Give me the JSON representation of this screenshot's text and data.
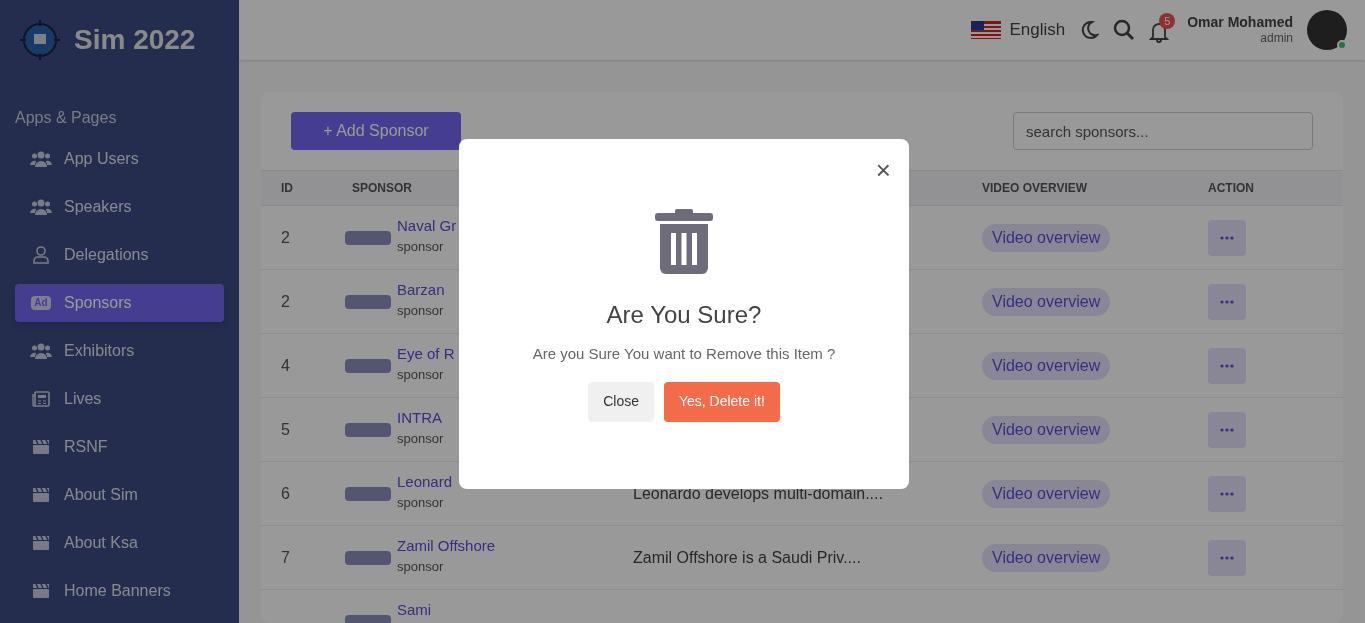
{
  "brand": {
    "title": "Sim 2022"
  },
  "sidebar": {
    "section": "Apps & Pages",
    "items": [
      {
        "label": "App Users",
        "kind": "users",
        "selected": false
      },
      {
        "label": "Speakers",
        "kind": "users",
        "selected": false
      },
      {
        "label": "Delegations",
        "kind": "user",
        "selected": false
      },
      {
        "label": "Sponsors",
        "kind": "ad",
        "icon_text": "Ad",
        "selected": true
      },
      {
        "label": "Exhibitors",
        "kind": "users",
        "selected": false
      },
      {
        "label": "Lives",
        "kind": "newspaper",
        "selected": false
      },
      {
        "label": "RSNF",
        "kind": "clapperboard",
        "selected": false
      },
      {
        "label": "About Sim",
        "kind": "clapperboard",
        "selected": false
      },
      {
        "label": "About Ksa",
        "kind": "clapperboard",
        "selected": false
      },
      {
        "label": "Home Banners",
        "kind": "clapperboard",
        "selected": false
      }
    ]
  },
  "header": {
    "language": "English",
    "notifications": "5",
    "user": {
      "name": "Omar Mohamed",
      "role": "admin",
      "online": true
    }
  },
  "toolbar": {
    "add_button": "+ Add Sponsor",
    "search": {
      "placeholder": "search sponsors..."
    }
  },
  "table": {
    "columns": [
      "ID",
      "SPONSOR",
      "VIDEO OVERVIEW",
      "ACTION"
    ],
    "rows": [
      {
        "id": "2",
        "name": "Naval Gr",
        "subtitle": "sponsor",
        "video": "Video overview"
      },
      {
        "id": "2",
        "name": "Barzan",
        "subtitle": "sponsor",
        "video": "Video overview"
      },
      {
        "id": "4",
        "name": "Eye of R",
        "subtitle": "sponsor",
        "video": "Video overview"
      },
      {
        "id": "5",
        "name": "INTRA",
        "subtitle": "sponsor",
        "video": "Video overview"
      },
      {
        "id": "6",
        "name": "Leonard",
        "subtitle": "sponsor",
        "description": "Leonardo develops multi-domain....",
        "video": "Video overview"
      },
      {
        "id": "7",
        "name": "Zamil Offshore",
        "subtitle": "sponsor",
        "description": "Zamil Offshore is a Saudi Priv....",
        "video": "Video overview"
      },
      {
        "name": "Sami"
      }
    ]
  },
  "modal": {
    "close": "×",
    "title": "Are You Sure?",
    "message": "Are you Sure You want to Remove this Item ?",
    "buttons": [
      {
        "label": "Close",
        "kind": "secondary"
      },
      {
        "label": "Yes, Delete it!",
        "kind": "danger"
      }
    ]
  }
}
